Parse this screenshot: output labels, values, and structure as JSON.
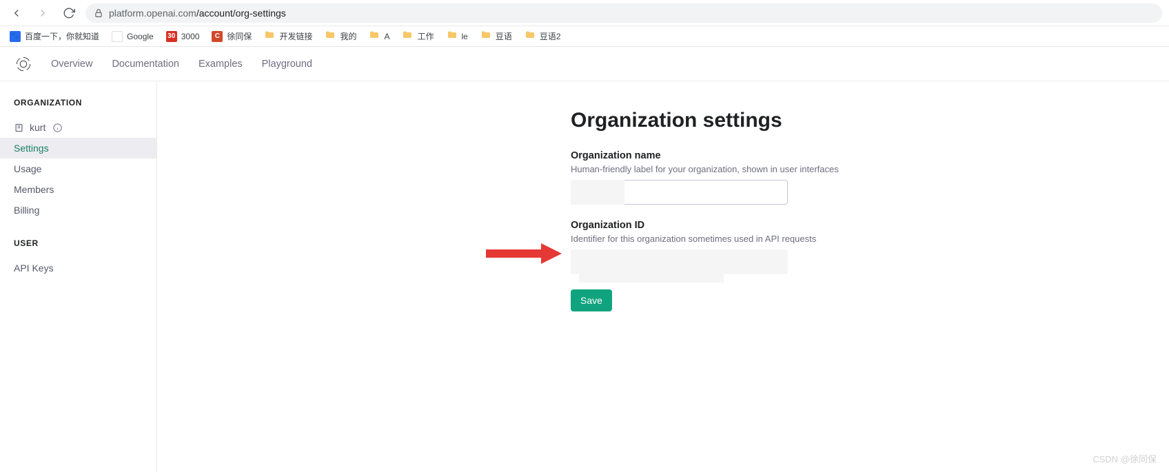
{
  "browser": {
    "url": "platform.openai.com/account/org-settings",
    "domain": "platform.openai.com",
    "path": "/account/org-settings"
  },
  "bookmarks": [
    {
      "id": "baidu",
      "label": "百度一下，你就知道",
      "kind": "site"
    },
    {
      "id": "google",
      "label": "Google",
      "kind": "site"
    },
    {
      "id": "3000",
      "label": "3000",
      "kind": "site"
    },
    {
      "id": "xtb",
      "label": "徐同保",
      "kind": "site"
    },
    {
      "id": "devlinks",
      "label": "开发链接",
      "kind": "folder"
    },
    {
      "id": "mine",
      "label": "我的",
      "kind": "folder"
    },
    {
      "id": "a",
      "label": "A",
      "kind": "folder"
    },
    {
      "id": "work",
      "label": "工作",
      "kind": "folder"
    },
    {
      "id": "le",
      "label": "le",
      "kind": "folder"
    },
    {
      "id": "douyu",
      "label": "豆语",
      "kind": "folder"
    },
    {
      "id": "douyu2",
      "label": "豆语2",
      "kind": "folder"
    }
  ],
  "top_nav": {
    "items": [
      "Overview",
      "Documentation",
      "Examples",
      "Playground"
    ]
  },
  "sidebar": {
    "org_title": "ORGANIZATION",
    "org_name": "kurt",
    "items": [
      "Settings",
      "Usage",
      "Members",
      "Billing"
    ],
    "active": "Settings",
    "user_title": "USER",
    "user_items": [
      "API Keys"
    ]
  },
  "page": {
    "title": "Organization settings",
    "org_name": {
      "label": "Organization name",
      "desc": "Human-friendly label for your organization, shown in user interfaces",
      "value": ""
    },
    "org_id": {
      "label": "Organization ID",
      "desc": "Identifier for this organization sometimes used in API requests",
      "value": ""
    },
    "save_label": "Save"
  },
  "watermark": "CSDN @徐同保"
}
